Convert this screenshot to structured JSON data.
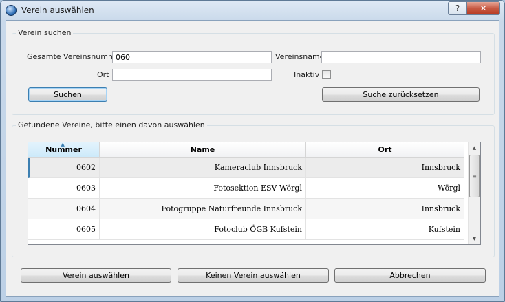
{
  "window": {
    "title": "Verein auswählen",
    "help_label": "?",
    "close_label": "✕"
  },
  "search_group": {
    "legend": "Verein suchen",
    "number_label": "Gesamte Vereinsnummer",
    "number_value": "060",
    "name_label": "Vereinsname",
    "name_value": "",
    "ort_label": "Ort",
    "ort_value": "",
    "inaktiv_label": "Inaktiv",
    "inaktiv_checked": false,
    "search_button": "Suchen",
    "reset_button": "Suche zurücksetzen"
  },
  "results_group": {
    "legend": "Gefundene Vereine, bitte einen davon auswählen",
    "columns": [
      "Nummer",
      "Name",
      "Ort"
    ],
    "sorted_column": "Nummer",
    "rows": [
      {
        "nummer": "0602",
        "name": "Kameraclub Innsbruck",
        "ort": "Innsbruck"
      },
      {
        "nummer": "0603",
        "name": "Fotosektion ESV Wörgl",
        "ort": "Wörgl"
      },
      {
        "nummer": "0604",
        "name": "Fotogruppe Naturfreunde Innsbruck",
        "ort": "Innsbruck"
      },
      {
        "nummer": "0605",
        "name": "Fotoclub ÖGB Kufstein",
        "ort": "Kufstein"
      }
    ]
  },
  "footer": {
    "select_button": "Verein auswählen",
    "none_button": "Keinen Verein auswählen",
    "cancel_button": "Abbrechen"
  },
  "colors": {
    "accent": "#3c7fb1",
    "client_bg": "#f0f0f0"
  }
}
